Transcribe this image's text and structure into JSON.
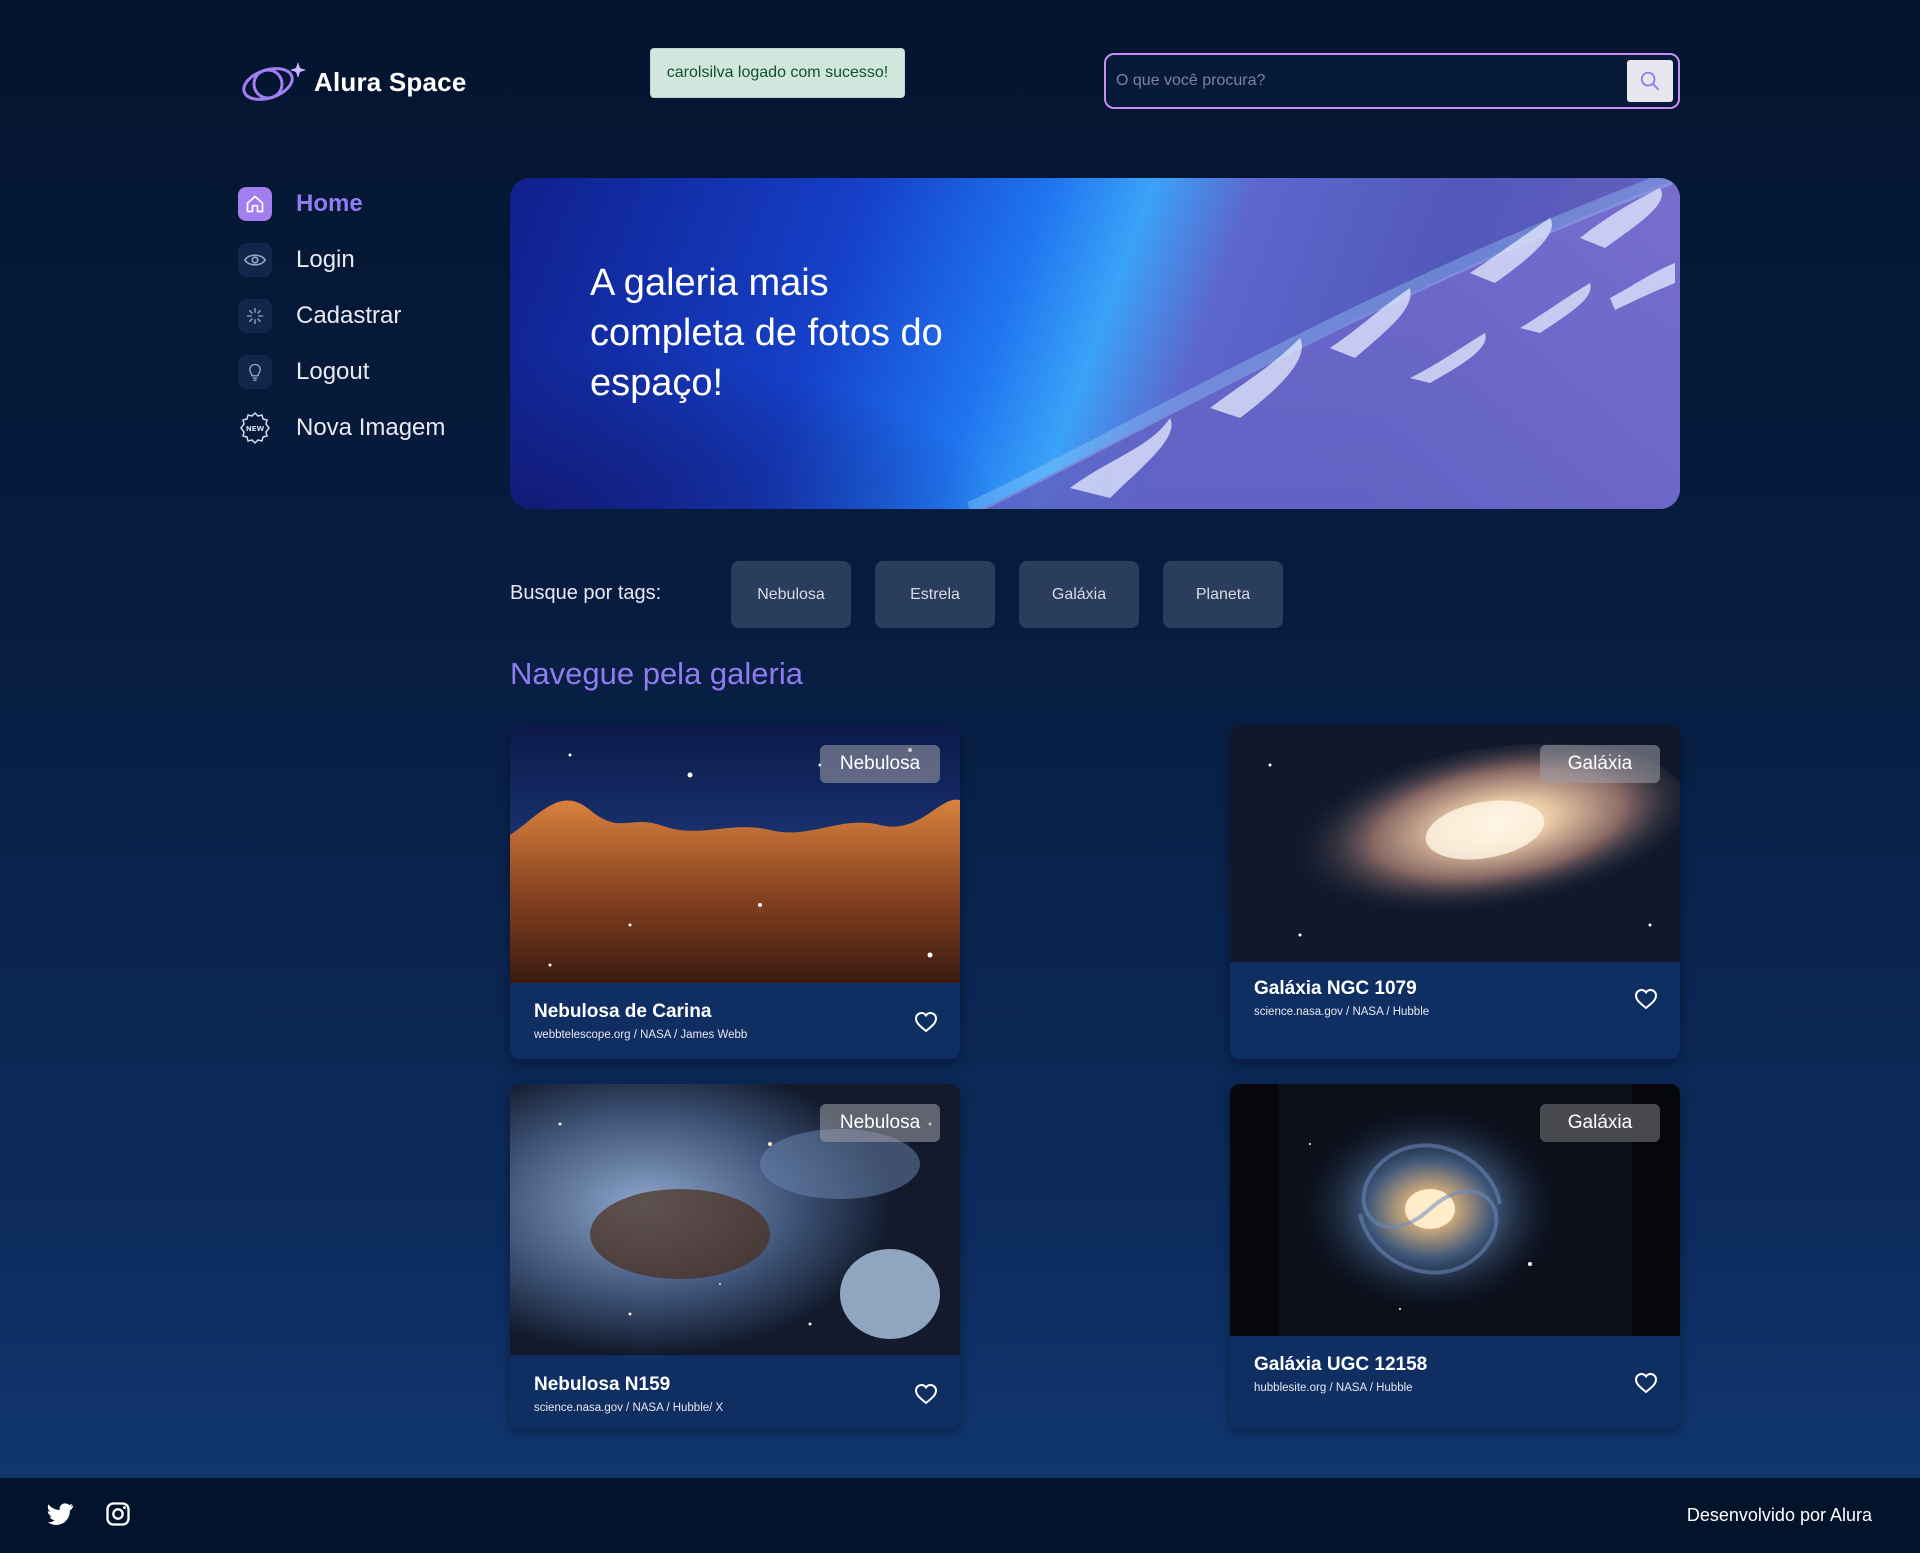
{
  "brand": {
    "name": "Alura Space"
  },
  "toast": {
    "message": "carolsilva logado com sucesso!"
  },
  "search": {
    "placeholder": "O que você procura?",
    "value": ""
  },
  "sidebar": {
    "items": [
      {
        "label": "Home",
        "icon": "home-icon",
        "active": true
      },
      {
        "label": "Login",
        "icon": "eye-icon",
        "active": false
      },
      {
        "label": "Cadastrar",
        "icon": "sparkle-icon",
        "active": false
      },
      {
        "label": "Logout",
        "icon": "lightbulb-icon",
        "active": false
      },
      {
        "label": "Nova Imagem",
        "icon": "new-badge-icon",
        "active": false
      }
    ]
  },
  "banner": {
    "title": "A galeria mais completa de fotos do espaço!"
  },
  "tags": {
    "label": "Busque por tags:",
    "items": [
      "Nebulosa",
      "Estrela",
      "Galáxia",
      "Planeta"
    ]
  },
  "gallery": {
    "title": "Navegue pela galeria",
    "cards": [
      {
        "title": "Nebulosa de Carina",
        "source": "webbtelescope.org / NASA / James Webb",
        "tag": "Nebulosa"
      },
      {
        "title": "Galáxia NGC 1079",
        "source": "science.nasa.gov / NASA / Hubble",
        "tag": "Galáxia"
      },
      {
        "title": "Nebulosa N159",
        "source": "science.nasa.gov / NASA / Hubble/ X",
        "tag": "Nebulosa"
      },
      {
        "title": "Galáxia UGC 12158",
        "source": "hubblesite.org / NASA / Hubble",
        "tag": "Galáxia"
      }
    ]
  },
  "footer": {
    "credit": "Desenvolvido por Alura",
    "social": [
      "twitter-icon",
      "instagram-icon"
    ]
  },
  "colors": {
    "accent": "#8f7cf0",
    "search_border": "#c98cf1",
    "tag_bg": "#2a3d5d",
    "card_bg": "#0f2f63",
    "toast_bg": "#d1e7dd"
  }
}
